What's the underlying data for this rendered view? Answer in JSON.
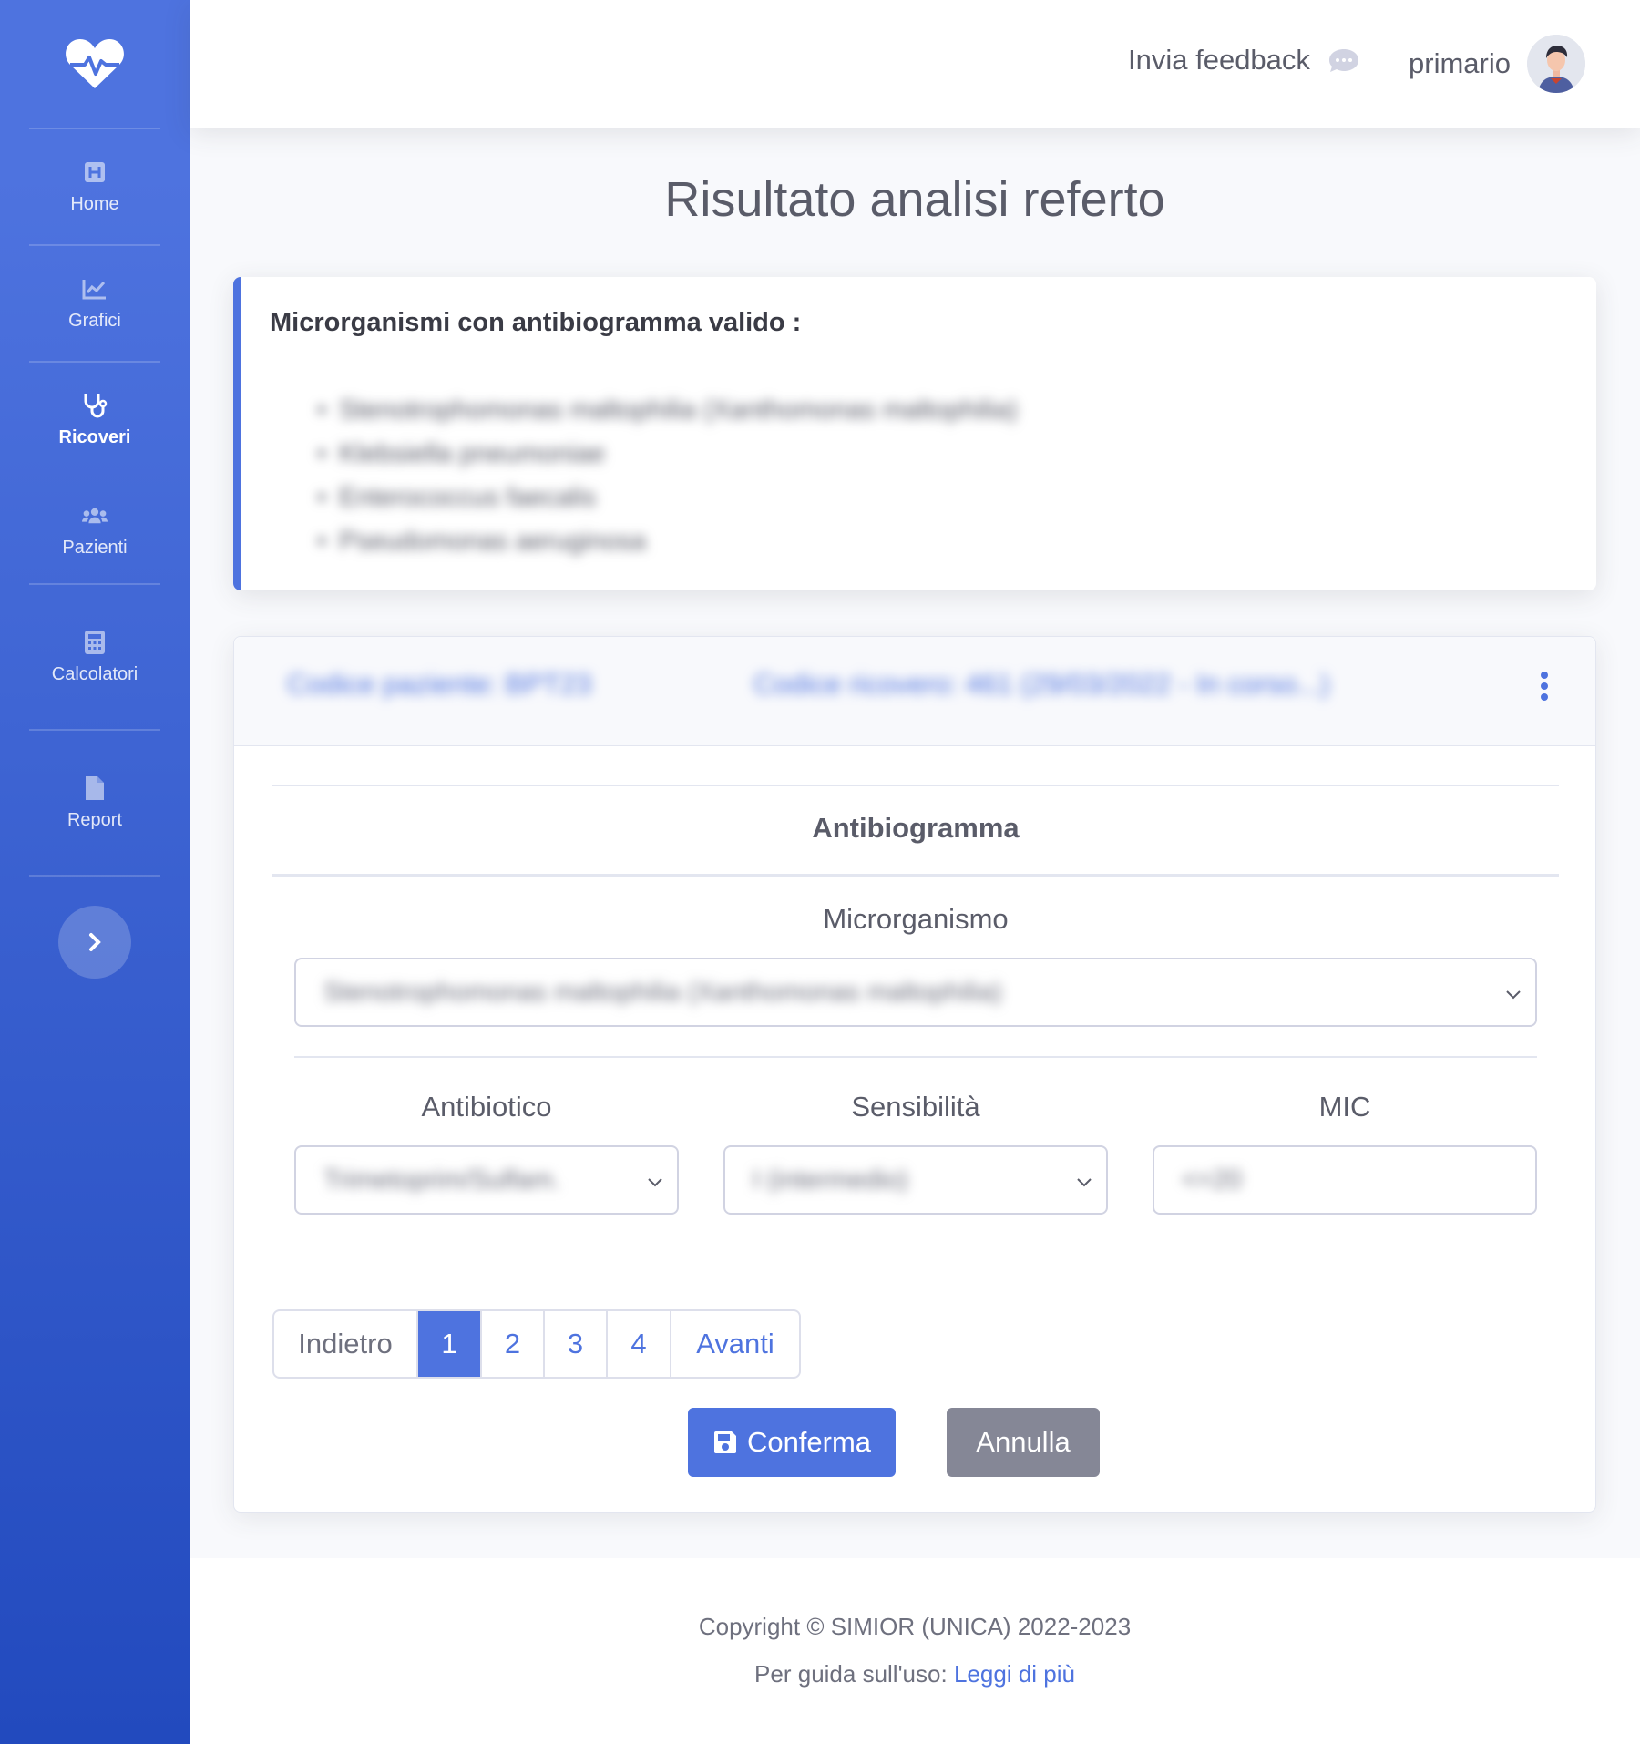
{
  "sidebar": {
    "items": [
      {
        "label": "Home",
        "icon": "hospital-icon"
      },
      {
        "label": "Grafici",
        "icon": "chart-area-icon"
      },
      {
        "label": "Ricoveri",
        "icon": "stethoscope-icon"
      },
      {
        "label": "Pazienti",
        "icon": "users-icon"
      },
      {
        "label": "Calcolatori",
        "icon": "calculator-icon"
      },
      {
        "label": "Report",
        "icon": "file-icon"
      }
    ],
    "active": "Ricoveri"
  },
  "topbar": {
    "feedback_label": "Invia feedback",
    "username": "primario"
  },
  "page": {
    "title": "Risultato analisi referto"
  },
  "microorganisms_card": {
    "heading": "Microrganismi con antibiogramma valido :",
    "items": [
      "Stenotrophomonas maltophilia (Xanthomonas maltophilia)",
      "Klebsiella pneumoniae",
      "Enterococcus faecalis",
      "Pseudomonas aeruginosa"
    ]
  },
  "patient_card": {
    "patient_code": "Codice paziente: BPT23",
    "admission_code": "Codice ricovero: 461 (29/03/2022 - In corso...)",
    "section_title": "Antibiogramma",
    "microorganism_label": "Microrganismo",
    "microorganism_value": "Stenotrophomonas maltophilia (Xanthomonas maltophilia)",
    "antibiotic_label": "Antibiotico",
    "antibiotic_value": "Trimetoprim/Sulfam.",
    "sensitivity_label": "Sensibilità",
    "sensitivity_value": "I (intermedio)",
    "mic_label": "MIC",
    "mic_value": "<=20"
  },
  "pagination": {
    "prev": "Indietro",
    "pages": [
      "1",
      "2",
      "3",
      "4"
    ],
    "active_page": "1",
    "next": "Avanti"
  },
  "actions": {
    "confirm": "Conferma",
    "cancel": "Annulla"
  },
  "footer": {
    "copyright": "Copyright © SIMIOR (UNICA) 2022-2023",
    "guide_prefix": "Per guida sull'uso:",
    "guide_link": "Leggi di più"
  },
  "colors": {
    "primary": "#4e73df",
    "secondary": "#858796",
    "sidebar_bottom": "#224abe"
  }
}
